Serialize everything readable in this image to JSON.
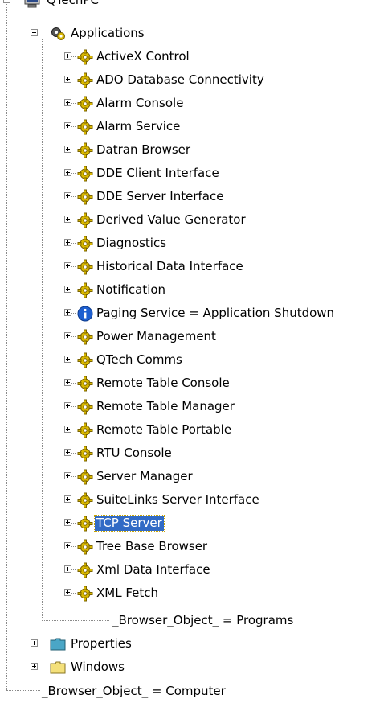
{
  "root": {
    "label": "QTechPC"
  },
  "applications": {
    "label": "Applications",
    "items": [
      {
        "label": "ActiveX Control",
        "icon": "gear-icon"
      },
      {
        "label": "ADO Database Connectivity",
        "icon": "gear-icon"
      },
      {
        "label": "Alarm Console",
        "icon": "gear-icon"
      },
      {
        "label": "Alarm Service",
        "icon": "gear-icon"
      },
      {
        "label": "Datran Browser",
        "icon": "gear-icon"
      },
      {
        "label": "DDE Client Interface",
        "icon": "gear-icon"
      },
      {
        "label": "DDE Server Interface",
        "icon": "gear-icon"
      },
      {
        "label": "Derived Value Generator",
        "icon": "gear-icon"
      },
      {
        "label": "Diagnostics",
        "icon": "gear-icon"
      },
      {
        "label": "Historical Data Interface",
        "icon": "gear-icon"
      },
      {
        "label": "Notification",
        "icon": "gear-icon"
      },
      {
        "label": "Paging Service = Application Shutdown",
        "icon": "info-icon"
      },
      {
        "label": "Power Management",
        "icon": "gear-icon"
      },
      {
        "label": "QTech Comms",
        "icon": "gear-icon"
      },
      {
        "label": "Remote Table Console",
        "icon": "gear-icon"
      },
      {
        "label": "Remote Table Manager",
        "icon": "gear-icon"
      },
      {
        "label": "Remote Table Portable",
        "icon": "gear-icon"
      },
      {
        "label": "RTU Console",
        "icon": "gear-icon"
      },
      {
        "label": "Server Manager",
        "icon": "gear-icon"
      },
      {
        "label": "SuiteLinks Server Interface",
        "icon": "gear-icon"
      },
      {
        "label": "TCP Server",
        "icon": "gear-icon",
        "selected": true
      },
      {
        "label": "Tree Base Browser",
        "icon": "gear-icon"
      },
      {
        "label": "Xml Data Interface",
        "icon": "gear-icon"
      },
      {
        "label": "XML Fetch",
        "icon": "gear-icon"
      }
    ],
    "browser_object": "_Browser_Object_ = Programs"
  },
  "properties": {
    "label": "Properties",
    "icon": "folder-icon"
  },
  "windows": {
    "label": "Windows",
    "icon": "folder-icon"
  },
  "root_browser_object": "_Browser_Object_ = Computer",
  "colors": {
    "selection": "#316ac5",
    "info": "#1e5fd0",
    "gear": "#d9b800",
    "folder_tab": "#4aa6c6",
    "folder_yellow": "#f4e07a"
  }
}
